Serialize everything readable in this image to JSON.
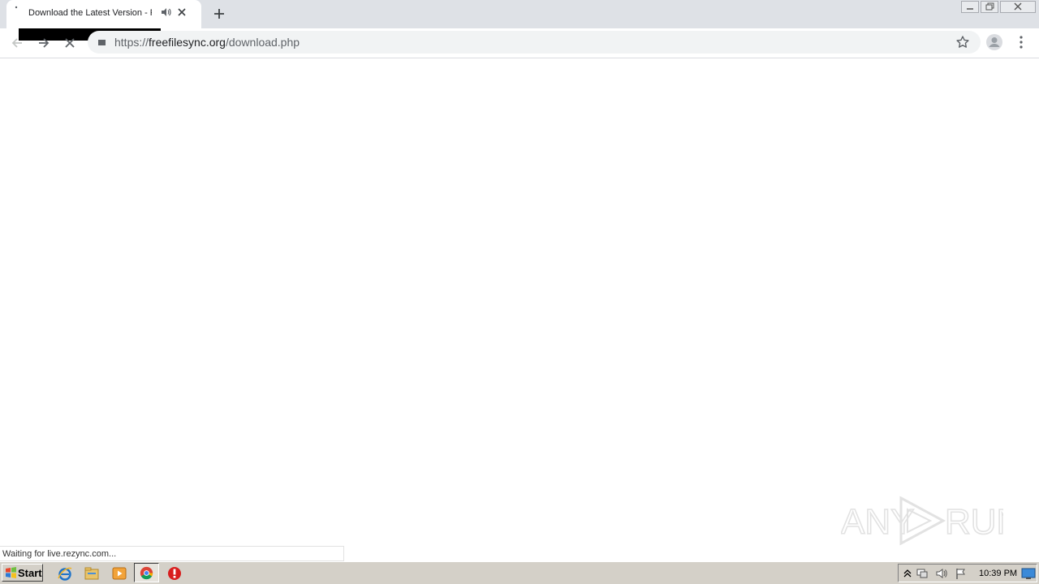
{
  "browser": {
    "tab": {
      "title": "Download the Latest Version - F"
    },
    "address_bar": {
      "scheme": "https://",
      "host": "freefilesync.org",
      "path": "/download.php"
    },
    "status_text": "Waiting for live.rezync.com..."
  },
  "watermark": {
    "text_left": "ANY",
    "text_right": "RUN"
  },
  "taskbar": {
    "start_label": "Start",
    "clock": "10:39 PM"
  },
  "colors": {
    "tabstrip": "#dee1e6",
    "omnibox": "#f1f3f4",
    "taskbar": "#d4d0c8",
    "watermark": "#e4e4e4"
  }
}
